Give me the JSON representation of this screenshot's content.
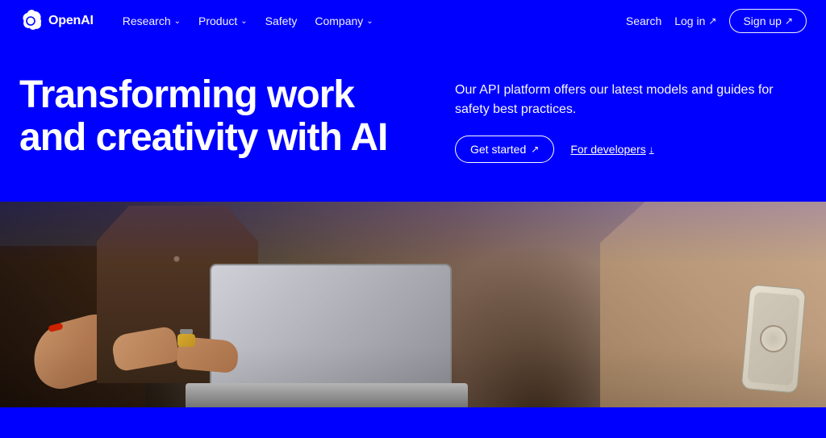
{
  "brand": {
    "name": "OpenAI",
    "logo_alt": "OpenAI logo"
  },
  "navbar": {
    "background": "#0000ff",
    "links": [
      {
        "label": "Research",
        "has_dropdown": true
      },
      {
        "label": "Product",
        "has_dropdown": true
      },
      {
        "label": "Safety",
        "has_dropdown": false
      },
      {
        "label": "Company",
        "has_dropdown": true
      }
    ],
    "search_label": "Search",
    "login_label": "Log in",
    "login_icon": "↗",
    "signup_label": "Sign up",
    "signup_icon": "↗"
  },
  "hero": {
    "background": "#0000ff",
    "title": "Transforming work and creativity with AI",
    "description": "Our API platform offers our latest models and guides for safety best practices.",
    "cta_primary": "Get started",
    "cta_primary_icon": "↗",
    "cta_secondary": "For developers",
    "cta_secondary_icon": "↓"
  },
  "hero_image": {
    "alt": "Two people working on a laptop together on a couch"
  }
}
